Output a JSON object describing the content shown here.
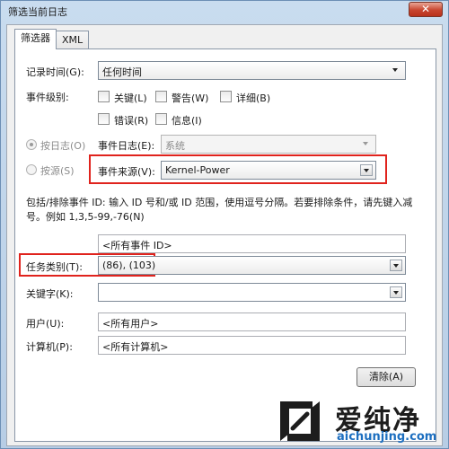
{
  "window": {
    "title": "筛选当前日志",
    "close_glyph": "✕"
  },
  "tabs": [
    {
      "label": "筛选器",
      "active": true
    },
    {
      "label": "XML",
      "active": false
    }
  ],
  "logged": {
    "label": "记录时间(G):",
    "value": "任何时间"
  },
  "event_level": {
    "label": "事件级别:",
    "options": [
      {
        "label": "关键(L)",
        "checked": false
      },
      {
        "label": "警告(W)",
        "checked": false
      },
      {
        "label": "详细(B)",
        "checked": false
      },
      {
        "label": "错误(R)",
        "checked": false
      },
      {
        "label": "信息(I)",
        "checked": false
      }
    ]
  },
  "by_log": {
    "radio_label": "按日志(O)",
    "field_label": "事件日志(E):",
    "value": "系统",
    "selected": true
  },
  "by_source": {
    "radio_label": "按源(S)",
    "field_label": "事件来源(V):",
    "value": "Kernel-Power",
    "selected": false
  },
  "event_id": {
    "description": "包括/排除事件 ID: 输入 ID 号和/或 ID 范围，使用逗号分隔。若要排除条件，请先键入减号。例如 1,3,5-99,-76(N)",
    "value": "<所有事件 ID>"
  },
  "task_category": {
    "label": "任务类别(T):",
    "value": "(86), (103)"
  },
  "keywords": {
    "label": "关键字(K):",
    "value": ""
  },
  "user": {
    "label": "用户(U):",
    "value": "<所有用户>"
  },
  "computer": {
    "label": "计算机(P):",
    "value": "<所有计算机>"
  },
  "clear_button": "清除(A)",
  "watermark": {
    "name": "爱纯净",
    "url": "aichunjing.com"
  },
  "colors": {
    "highlight": "#e0231d",
    "title_bar": "#c9dcef",
    "watermark_url": "#1d6fc0"
  }
}
